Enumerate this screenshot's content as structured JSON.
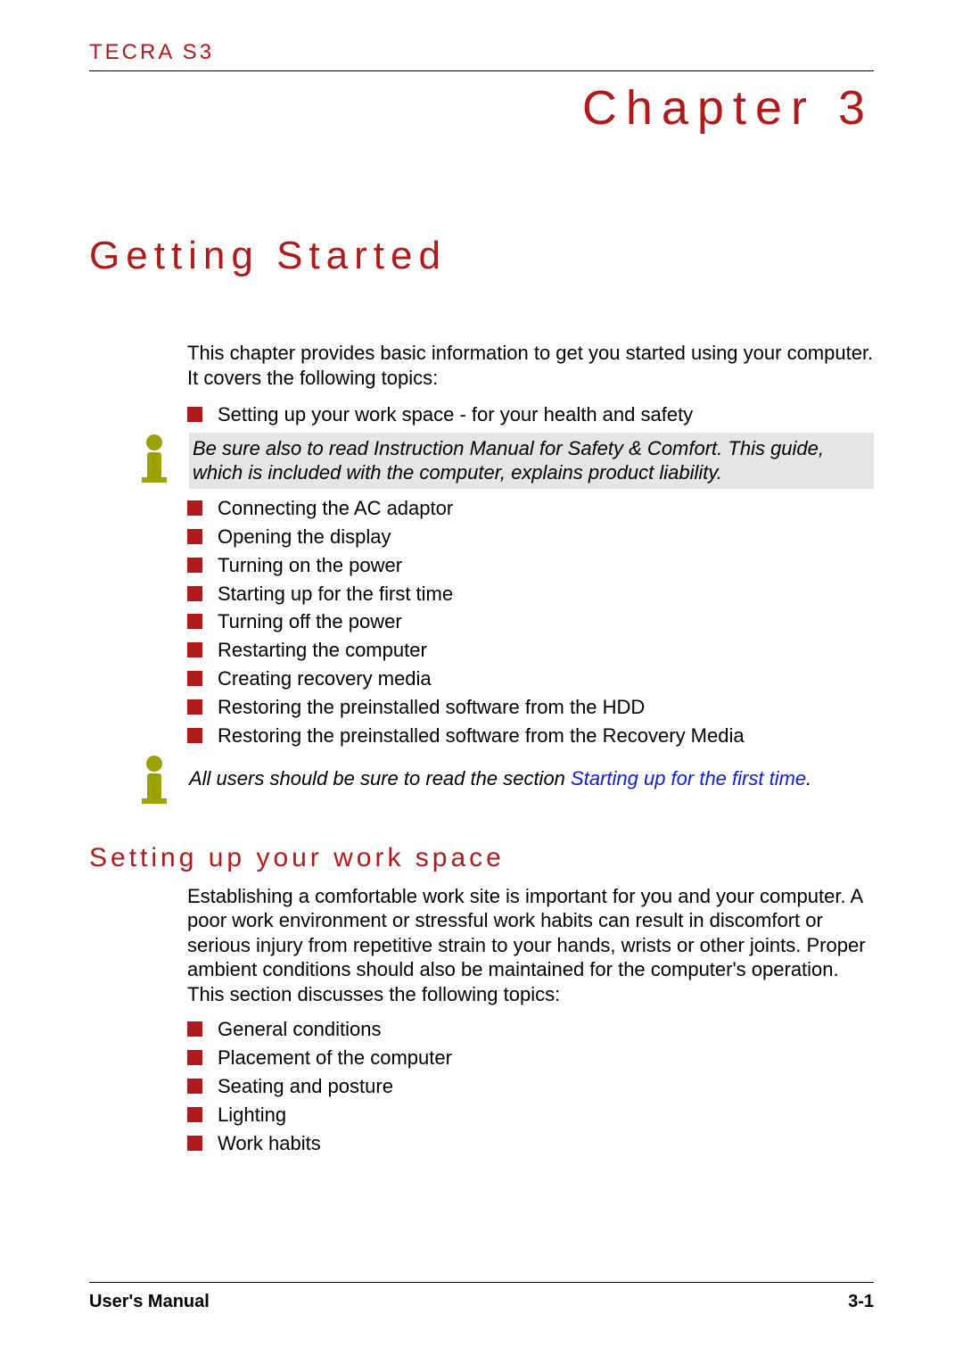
{
  "header": {
    "product": "TECRA S3",
    "chapter_label": "Chapter 3",
    "chapter_title": "Getting Started"
  },
  "intro": "This chapter provides basic information to get you started using your computer. It covers the following topics:",
  "topics1": [
    "Setting up your work space - for your health and safety"
  ],
  "note1": "Be sure also to read Instruction Manual for Safety & Comfort. This guide, which is included with the computer, explains product liability.",
  "topics2": [
    "Connecting the AC adaptor",
    "Opening the display",
    "Turning on the power",
    "Starting up for the first time",
    "Turning off the power",
    "Restarting the computer",
    "Creating recovery media",
    "Restoring the preinstalled software from the HDD",
    "Restoring the preinstalled software from the Recovery Media"
  ],
  "note2_prefix": "All users should be sure to read the section ",
  "note2_link": "Starting up for the first time",
  "note2_suffix": ".",
  "section": {
    "title": "Setting up your work space",
    "para": "Establishing a comfortable work site is important for you and your computer. A poor work environment or stressful work habits can result in discomfort or serious injury from repetitive strain to your hands, wrists or other joints. Proper ambient conditions should also be maintained for the computer's operation. This section discusses the following topics:",
    "items": [
      "General conditions",
      "Placement of the computer",
      "Seating and posture",
      "Lighting",
      "Work habits"
    ]
  },
  "footer": {
    "left": "User's Manual",
    "right": "3-1"
  }
}
